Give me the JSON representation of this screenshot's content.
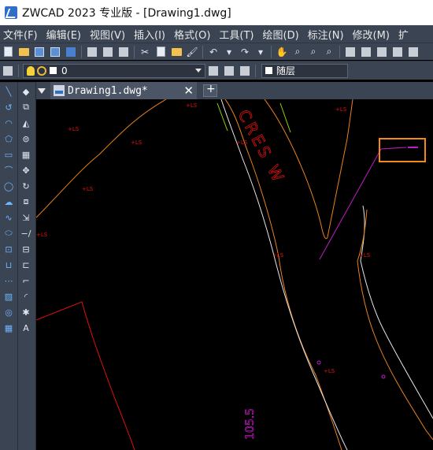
{
  "window": {
    "title": "ZWCAD 2023 专业版 - [Drawing1.dwg]"
  },
  "menu": {
    "items": [
      {
        "label": "文件(F)"
      },
      {
        "label": "编辑(E)"
      },
      {
        "label": "视图(V)"
      },
      {
        "label": "插入(I)"
      },
      {
        "label": "格式(O)"
      },
      {
        "label": "工具(T)"
      },
      {
        "label": "绘图(D)"
      },
      {
        "label": "标注(N)"
      },
      {
        "label": "修改(M)"
      },
      {
        "label": "扩"
      }
    ]
  },
  "layer_toolbar": {
    "current_layer": "0",
    "color_value": "随层"
  },
  "tabs": {
    "active_document": "Drawing1.dwg*"
  },
  "drawing": {
    "street_label": "CRES W",
    "elevation_label": "105.5",
    "point_marker": "LS",
    "colors": {
      "orange": "#e8821e",
      "magenta": "#c41ac4",
      "red": "#e01010",
      "white": "#e6e6e6",
      "green": "#8fd400",
      "highlight_box": "#f28a16"
    }
  },
  "icons": [
    "app-logo-icon",
    "new-file-icon",
    "open-folder-icon",
    "save-icon",
    "save-as-icon",
    "print-icon",
    "cut-icon",
    "copy-icon",
    "paste-icon",
    "undo-icon",
    "redo-icon",
    "pan-icon",
    "zoom-icon",
    "layer-manager-icon",
    "bulb-icon",
    "sun-icon",
    "line-icon",
    "eraser-icon",
    "polyline-icon",
    "copy-object-icon",
    "arc-icon",
    "mirror-icon",
    "polygon-icon",
    "offset-icon",
    "rectangle-icon",
    "array-icon",
    "move-icon",
    "circle-icon",
    "rotate-icon",
    "revision-cloud-icon",
    "scale-icon",
    "spline-icon",
    "stretch-icon",
    "ellipse-icon",
    "trim-icon",
    "extend-icon",
    "insert-block-icon",
    "break-icon",
    "make-block-icon",
    "join-icon",
    "point-icon",
    "chamfer-icon",
    "hatch-icon",
    "fillet-icon",
    "region-icon",
    "explode-icon",
    "table-icon",
    "multiline-text-icon"
  ]
}
